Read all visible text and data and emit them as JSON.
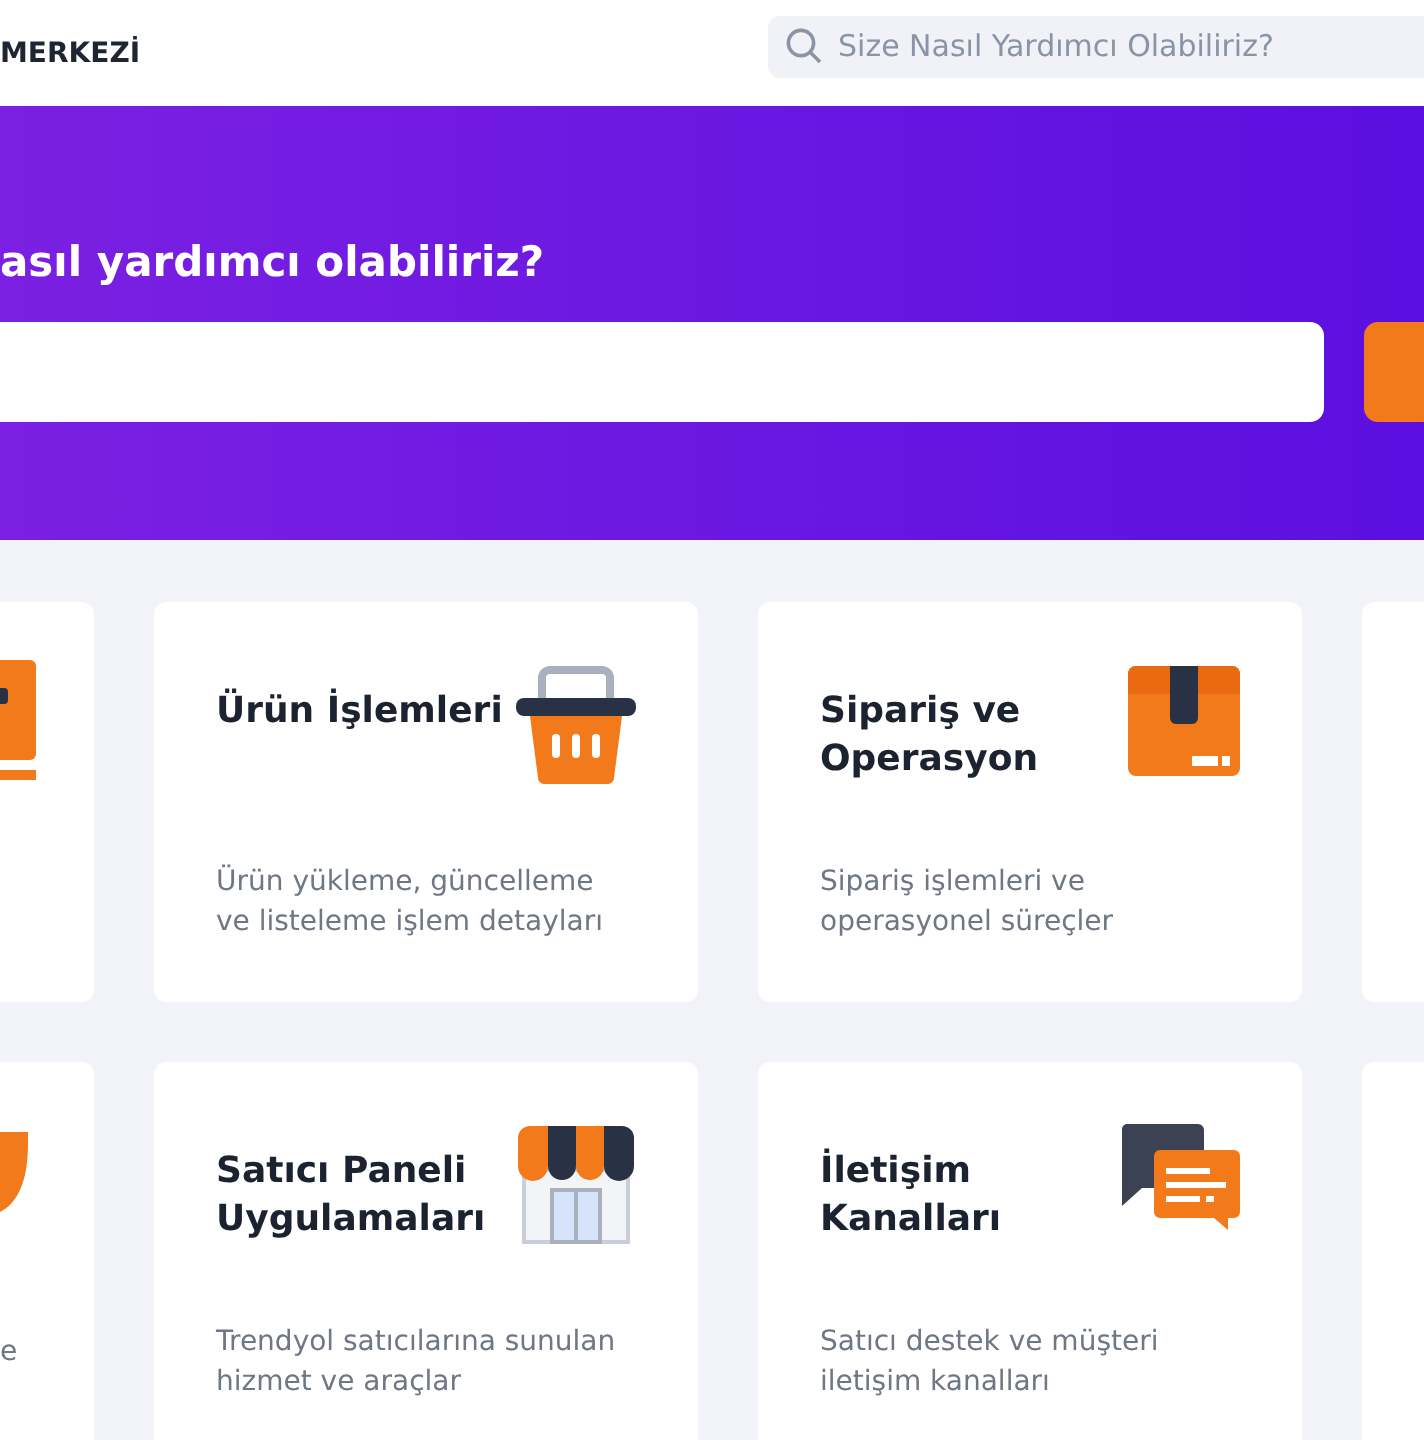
{
  "header": {
    "logo_text": "MERKEZİ",
    "search": {
      "placeholder": "Size Nasıl Yardımcı Olabiliriz?"
    }
  },
  "hero": {
    "title": "asıl yardımcı olabiliriz?"
  },
  "card_rows": [
    [
      {
        "kind": "partial-left"
      },
      {
        "kind": "full",
        "title": "Ürün İşlemleri",
        "description": "Ürün yükleme, güncelleme ve listeleme işlem detayları"
      },
      {
        "kind": "full",
        "title": "Sipariş ve Operasyon",
        "description": "Sipariş işlemleri ve operasyonel süreçler"
      },
      {
        "kind": "partial-right"
      }
    ],
    [
      {
        "kind": "partial-left",
        "description": "e"
      },
      {
        "kind": "full",
        "title": "Satıcı Paneli Uygulamaları",
        "description": "Trendyol satıcılarına sunulan hizmet ve araçlar"
      },
      {
        "kind": "full",
        "title": "İletişim Kanalları",
        "description": "Satıcı destek ve müşteri iletişim kanalları"
      },
      {
        "kind": "partial-right"
      }
    ]
  ]
}
